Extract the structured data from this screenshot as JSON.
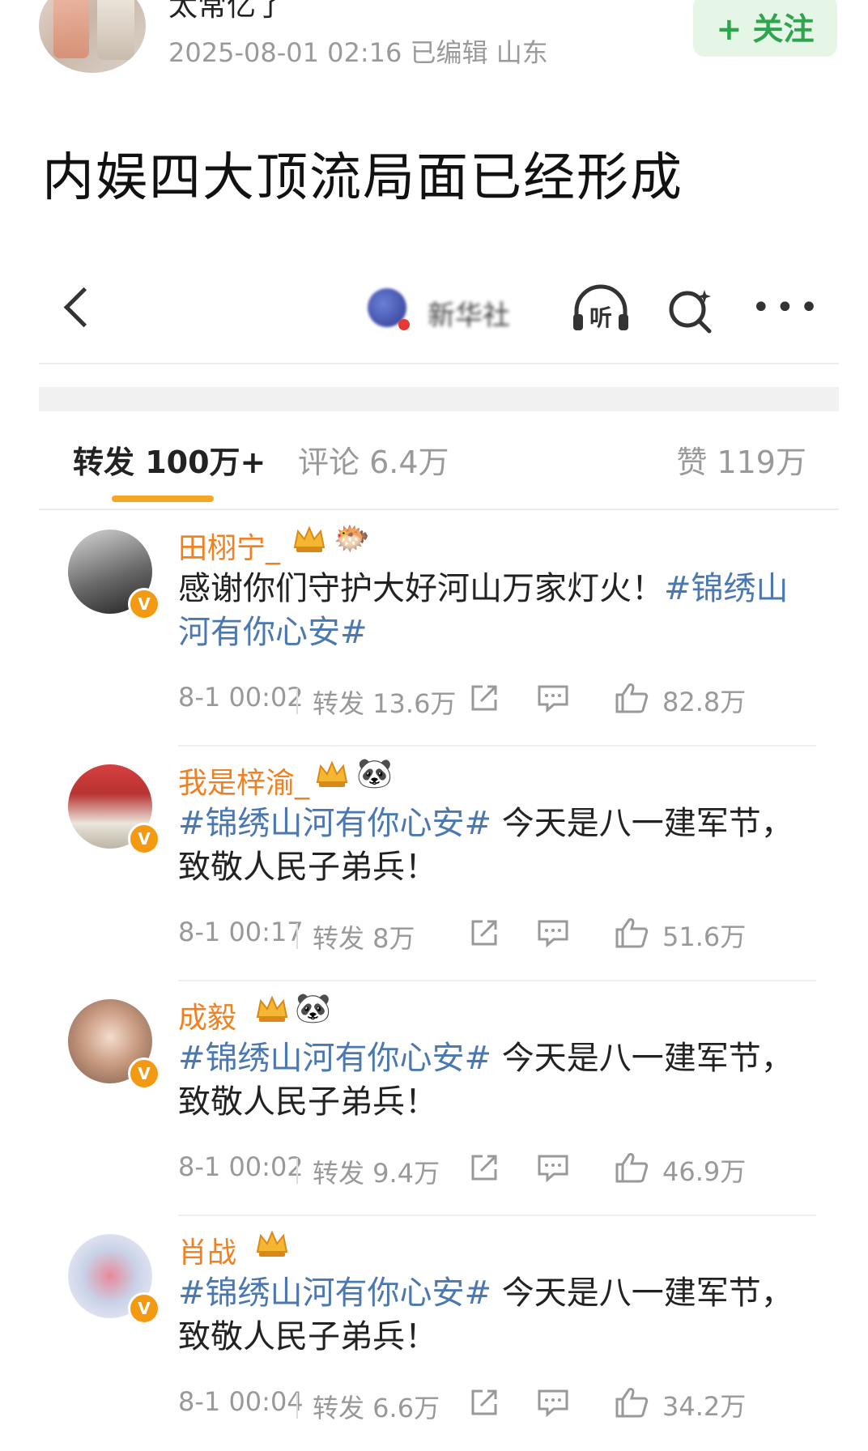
{
  "post": {
    "author": "太常亿了",
    "meta": "2025-08-01 02:16  已编辑  山东",
    "follow_label": "+ 关注",
    "title": "内娱四大顶流局面已经形成"
  },
  "embed": {
    "account_name": "新华社",
    "tabs": {
      "repost": "转发 100万+",
      "comment": "评论 6.4万",
      "like": "赞 119万"
    },
    "items": [
      {
        "name": "田栩宁_",
        "emoji": "🐡",
        "tag": "#锦绣山河有你心安#",
        "body": "感谢你们守护大好河山万家灯火！",
        "time": "8-1 00:02",
        "repost": "转发 13.6万",
        "likes": "82.8万"
      },
      {
        "name": "我是梓渝_",
        "emoji": "🐼",
        "tag": "#锦绣山河有你心安#",
        "body": " 今天是八一建军节，致敬人民子弟兵！",
        "time": "8-1 00:17",
        "repost": "转发 8万",
        "likes": "51.6万"
      },
      {
        "name": "成毅",
        "emoji": "🐼",
        "tag": "#锦绣山河有你心安#",
        "body": " 今天是八一建军节，致敬人民子弟兵！",
        "time": "8-1 00:02",
        "repost": "转发 9.4万",
        "likes": "46.9万"
      },
      {
        "name": "肖战",
        "emoji": "",
        "tag": "#锦绣山河有你心安#",
        "body": " 今天是八一建军节，致敬人民子弟兵！",
        "time": "8-1 00:04",
        "repost": "转发 6.6万",
        "likes": "34.2万"
      }
    ]
  }
}
